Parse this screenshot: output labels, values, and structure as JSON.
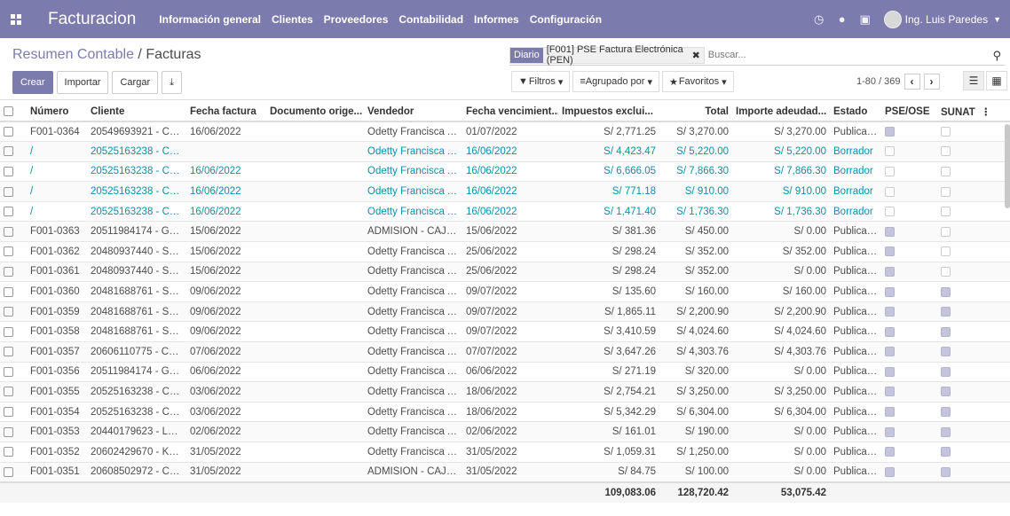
{
  "navbar": {
    "brand": "Facturacion",
    "menu": [
      "Información general",
      "Clientes",
      "Proveedores",
      "Contabilidad",
      "Informes",
      "Configuración"
    ],
    "user": "Ing. Luis Paredes"
  },
  "control_panel": {
    "breadcrumb_parent": "Resumen Contable",
    "breadcrumb_sep": " / ",
    "breadcrumb_current": "Facturas",
    "buttons": {
      "create": "Crear",
      "import": "Importar",
      "upload": "Cargar"
    },
    "search": {
      "facet_category": "Diario",
      "facet_value": "[F001] PSE Factura Electrónica (PEN)",
      "placeholder": "Buscar..."
    },
    "filters": {
      "filters": "Filtros",
      "group_by": "Agrupado por",
      "favorites": "Favoritos"
    },
    "pager": "1-80 / 369"
  },
  "table": {
    "columns": [
      "Número",
      "Cliente",
      "Fecha factura",
      "Documento orige...",
      "Vendedor",
      "Fecha vencimient...",
      "Impuestos exclui...",
      "Total",
      "Importe adeudad...",
      "Estado",
      "PSE/OSE",
      "SUNAT"
    ],
    "rows": [
      {
        "num": "F001-0364",
        "cliente": "20549693921 - CE...",
        "fecha": "16/06/2022",
        "doc": "",
        "vendedor": "Odetty Francisca A...",
        "venc": "01/07/2022",
        "imp": "S/ 2,771.25",
        "total": "S/ 3,270.00",
        "adeudado": "S/ 3,270.00",
        "estado": "Publicado",
        "pse": true,
        "sunat": false,
        "draft": false
      },
      {
        "num": "/",
        "cliente": "20525163238 - CA...",
        "fecha": "",
        "doc": "",
        "vendedor": "Odetty Francisca A...",
        "venc": "16/06/2022",
        "imp": "S/ 4,423.47",
        "total": "S/ 5,220.00",
        "adeudado": "S/ 5,220.00",
        "estado": "Borrador",
        "pse": false,
        "sunat": false,
        "draft": true
      },
      {
        "num": "/",
        "cliente": "20525163238 - CA...",
        "fecha": "16/06/2022",
        "doc": "",
        "vendedor": "Odetty Francisca A...",
        "venc": "16/06/2022",
        "imp": "S/ 6,666.05",
        "total": "S/ 7,866.30",
        "adeudado": "S/ 7,866.30",
        "estado": "Borrador",
        "pse": false,
        "sunat": false,
        "draft": true
      },
      {
        "num": "/",
        "cliente": "20525163238 - CA...",
        "fecha": "16/06/2022",
        "doc": "",
        "vendedor": "Odetty Francisca A...",
        "venc": "16/06/2022",
        "imp": "S/ 771.18",
        "total": "S/ 910.00",
        "adeudado": "S/ 910.00",
        "estado": "Borrador",
        "pse": false,
        "sunat": false,
        "draft": true
      },
      {
        "num": "/",
        "cliente": "20525163238 - CA...",
        "fecha": "16/06/2022",
        "doc": "",
        "vendedor": "Odetty Francisca A...",
        "venc": "16/06/2022",
        "imp": "S/ 1,471.40",
        "total": "S/ 1,736.30",
        "adeudado": "S/ 1,736.30",
        "estado": "Borrador",
        "pse": false,
        "sunat": false,
        "draft": true
      },
      {
        "num": "F001-0363",
        "cliente": "20511984174 - GR...",
        "fecha": "15/06/2022",
        "doc": "",
        "vendedor": "ADMISION - CAJA ...",
        "venc": "15/06/2022",
        "imp": "S/ 381.36",
        "total": "S/ 450.00",
        "adeudado": "S/ 0.00",
        "estado": "Publicado",
        "pse": true,
        "sunat": false,
        "draft": false
      },
      {
        "num": "F001-0362",
        "cliente": "20480937440 - SE...",
        "fecha": "15/06/2022",
        "doc": "",
        "vendedor": "Odetty Francisca A...",
        "venc": "25/06/2022",
        "imp": "S/ 298.24",
        "total": "S/ 352.00",
        "adeudado": "S/ 352.00",
        "estado": "Publicado",
        "pse": true,
        "sunat": false,
        "draft": false
      },
      {
        "num": "F001-0361",
        "cliente": "20480937440 - SE...",
        "fecha": "15/06/2022",
        "doc": "",
        "vendedor": "Odetty Francisca A...",
        "venc": "25/06/2022",
        "imp": "S/ 298.24",
        "total": "S/ 352.00",
        "adeudado": "S/ 0.00",
        "estado": "Publicado",
        "pse": true,
        "sunat": false,
        "draft": false
      },
      {
        "num": "F001-0360",
        "cliente": "20481688761 - SE...",
        "fecha": "09/06/2022",
        "doc": "",
        "vendedor": "Odetty Francisca A...",
        "venc": "09/07/2022",
        "imp": "S/ 135.60",
        "total": "S/ 160.00",
        "adeudado": "S/ 160.00",
        "estado": "Publicado",
        "pse": true,
        "sunat": true,
        "draft": false
      },
      {
        "num": "F001-0359",
        "cliente": "20481688761 - SE...",
        "fecha": "09/06/2022",
        "doc": "",
        "vendedor": "Odetty Francisca A...",
        "venc": "09/07/2022",
        "imp": "S/ 1,865.11",
        "total": "S/ 2,200.90",
        "adeudado": "S/ 2,200.90",
        "estado": "Publicado",
        "pse": true,
        "sunat": true,
        "draft": false
      },
      {
        "num": "F001-0358",
        "cliente": "20481688761 - SE...",
        "fecha": "09/06/2022",
        "doc": "",
        "vendedor": "Odetty Francisca A...",
        "venc": "09/07/2022",
        "imp": "S/ 3,410.59",
        "total": "S/ 4,024.60",
        "adeudado": "S/ 4,024.60",
        "estado": "Publicado",
        "pse": true,
        "sunat": true,
        "draft": false
      },
      {
        "num": "F001-0357",
        "cliente": "20606110775 - CO...",
        "fecha": "07/06/2022",
        "doc": "",
        "vendedor": "Odetty Francisca A...",
        "venc": "07/07/2022",
        "imp": "S/ 3,647.26",
        "total": "S/ 4,303.76",
        "adeudado": "S/ 4,303.76",
        "estado": "Publicado",
        "pse": true,
        "sunat": true,
        "draft": false
      },
      {
        "num": "F001-0356",
        "cliente": "20511984174 - GR...",
        "fecha": "06/06/2022",
        "doc": "",
        "vendedor": "Odetty Francisca A...",
        "venc": "06/06/2022",
        "imp": "S/ 271.19",
        "total": "S/ 320.00",
        "adeudado": "S/ 0.00",
        "estado": "Publicado",
        "pse": true,
        "sunat": true,
        "draft": false
      },
      {
        "num": "F001-0355",
        "cliente": "20525163238 - CA...",
        "fecha": "03/06/2022",
        "doc": "",
        "vendedor": "Odetty Francisca A...",
        "venc": "18/06/2022",
        "imp": "S/ 2,754.21",
        "total": "S/ 3,250.00",
        "adeudado": "S/ 3,250.00",
        "estado": "Publicado",
        "pse": true,
        "sunat": true,
        "draft": false
      },
      {
        "num": "F001-0354",
        "cliente": "20525163238 - CA...",
        "fecha": "03/06/2022",
        "doc": "",
        "vendedor": "Odetty Francisca A...",
        "venc": "18/06/2022",
        "imp": "S/ 5,342.29",
        "total": "S/ 6,304.00",
        "adeudado": "S/ 6,304.00",
        "estado": "Publicado",
        "pse": true,
        "sunat": true,
        "draft": false
      },
      {
        "num": "F001-0353",
        "cliente": "20440179623 - LA ...",
        "fecha": "02/06/2022",
        "doc": "",
        "vendedor": "Odetty Francisca A...",
        "venc": "02/06/2022",
        "imp": "S/ 161.01",
        "total": "S/ 190.00",
        "adeudado": "S/ 0.00",
        "estado": "Publicado",
        "pse": true,
        "sunat": true,
        "draft": false
      },
      {
        "num": "F001-0352",
        "cliente": "20602429670 - KO...",
        "fecha": "31/05/2022",
        "doc": "",
        "vendedor": "Odetty Francisca A...",
        "venc": "31/05/2022",
        "imp": "S/ 1,059.31",
        "total": "S/ 1,250.00",
        "adeudado": "S/ 0.00",
        "estado": "Publicado",
        "pse": true,
        "sunat": true,
        "draft": false
      },
      {
        "num": "F001-0351",
        "cliente": "20608502972 - CO...",
        "fecha": "31/05/2022",
        "doc": "",
        "vendedor": "ADMISION - CAJA ...",
        "venc": "31/05/2022",
        "imp": "S/ 84.75",
        "total": "S/ 100.00",
        "adeudado": "S/ 0.00",
        "estado": "Publicado",
        "pse": true,
        "sunat": true,
        "draft": false
      }
    ],
    "totals": {
      "imp": "109,083.06",
      "total": "128,720.42",
      "adeudado": "53,075.42"
    }
  }
}
